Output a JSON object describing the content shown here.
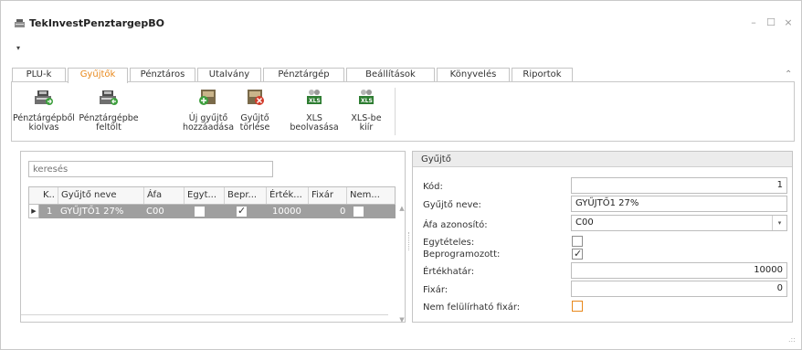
{
  "window": {
    "title": "TekInvestPenztargepBO",
    "minimize": "–",
    "maximize": "☐",
    "close": "×",
    "quick_access_arrow": "▾"
  },
  "tabs": [
    {
      "label": "PLU-k"
    },
    {
      "label": "Gyűjtők"
    },
    {
      "label": "Pénztáros"
    },
    {
      "label": "Utalvány"
    },
    {
      "label": "Pénztárgép"
    },
    {
      "label": "Beállítások"
    },
    {
      "label": "Könyvelés"
    },
    {
      "label": "Riportok"
    }
  ],
  "active_tab": "Gyűjtők",
  "ribbon_collapse": "⌃",
  "ribbon": {
    "buttons": [
      {
        "label": "Pénztárgépből\nkiolvas",
        "icon": "cash-register-export-icon"
      },
      {
        "label": "Pénztárgépbe\nfeltölt",
        "icon": "cash-register-import-icon"
      },
      {
        "label": "Új gyűjtő\nhozzáadása",
        "icon": "add-collector-icon"
      },
      {
        "label": "Gyűjtő\ntörlése",
        "icon": "delete-collector-icon"
      },
      {
        "label": "XLS\nbeolvasása",
        "icon": "xls-import-icon"
      },
      {
        "label": "XLS-be\nkiír",
        "icon": "xls-export-icon"
      }
    ]
  },
  "list": {
    "search_placeholder": "keresés",
    "columns": [
      "K..",
      "Gyűjtő neve",
      "Áfa",
      "Egyt...",
      "Bepr...",
      "Érték...",
      "Fixár",
      "Nem..."
    ],
    "rows": [
      {
        "k": "1",
        "name": "GYŰJTŐ1 27%",
        "afa": "C00",
        "egyteteles": false,
        "beprogramozott": true,
        "ertekhatar": "10000",
        "fixar": "0",
        "nem_felulirhato": false
      }
    ],
    "row_indicator": "▶",
    "scroll_up": "▲",
    "scroll_down": "▼"
  },
  "detail": {
    "title": "Gyűjtő",
    "kod_label": "Kód:",
    "kod_value": "1",
    "nev_label": "Gyűjtő neve:",
    "nev_value": "GYŰJTŐ1 27%",
    "afa_label": "Áfa azonosító:",
    "afa_value": "C00",
    "afa_dropdown": "▾",
    "egyteteles_label": "Egytételes:",
    "egyteteles_checked": false,
    "beprogramozott_label": "Beprogramozott:",
    "beprogramozott_checked": true,
    "ertekhatar_label": "Értékhatár:",
    "ertekhatar_value": "10000",
    "fixar_label": "Fixár:",
    "fixar_value": "0",
    "nem_felulirhato_label": "Nem felülírható fixár:",
    "nem_felulirhato_checked": false
  },
  "resize_grip": ".::",
  "colors": {
    "accent": "#e8881b",
    "selected_row": "#9f9f9f",
    "border": "#c5c5c5"
  }
}
